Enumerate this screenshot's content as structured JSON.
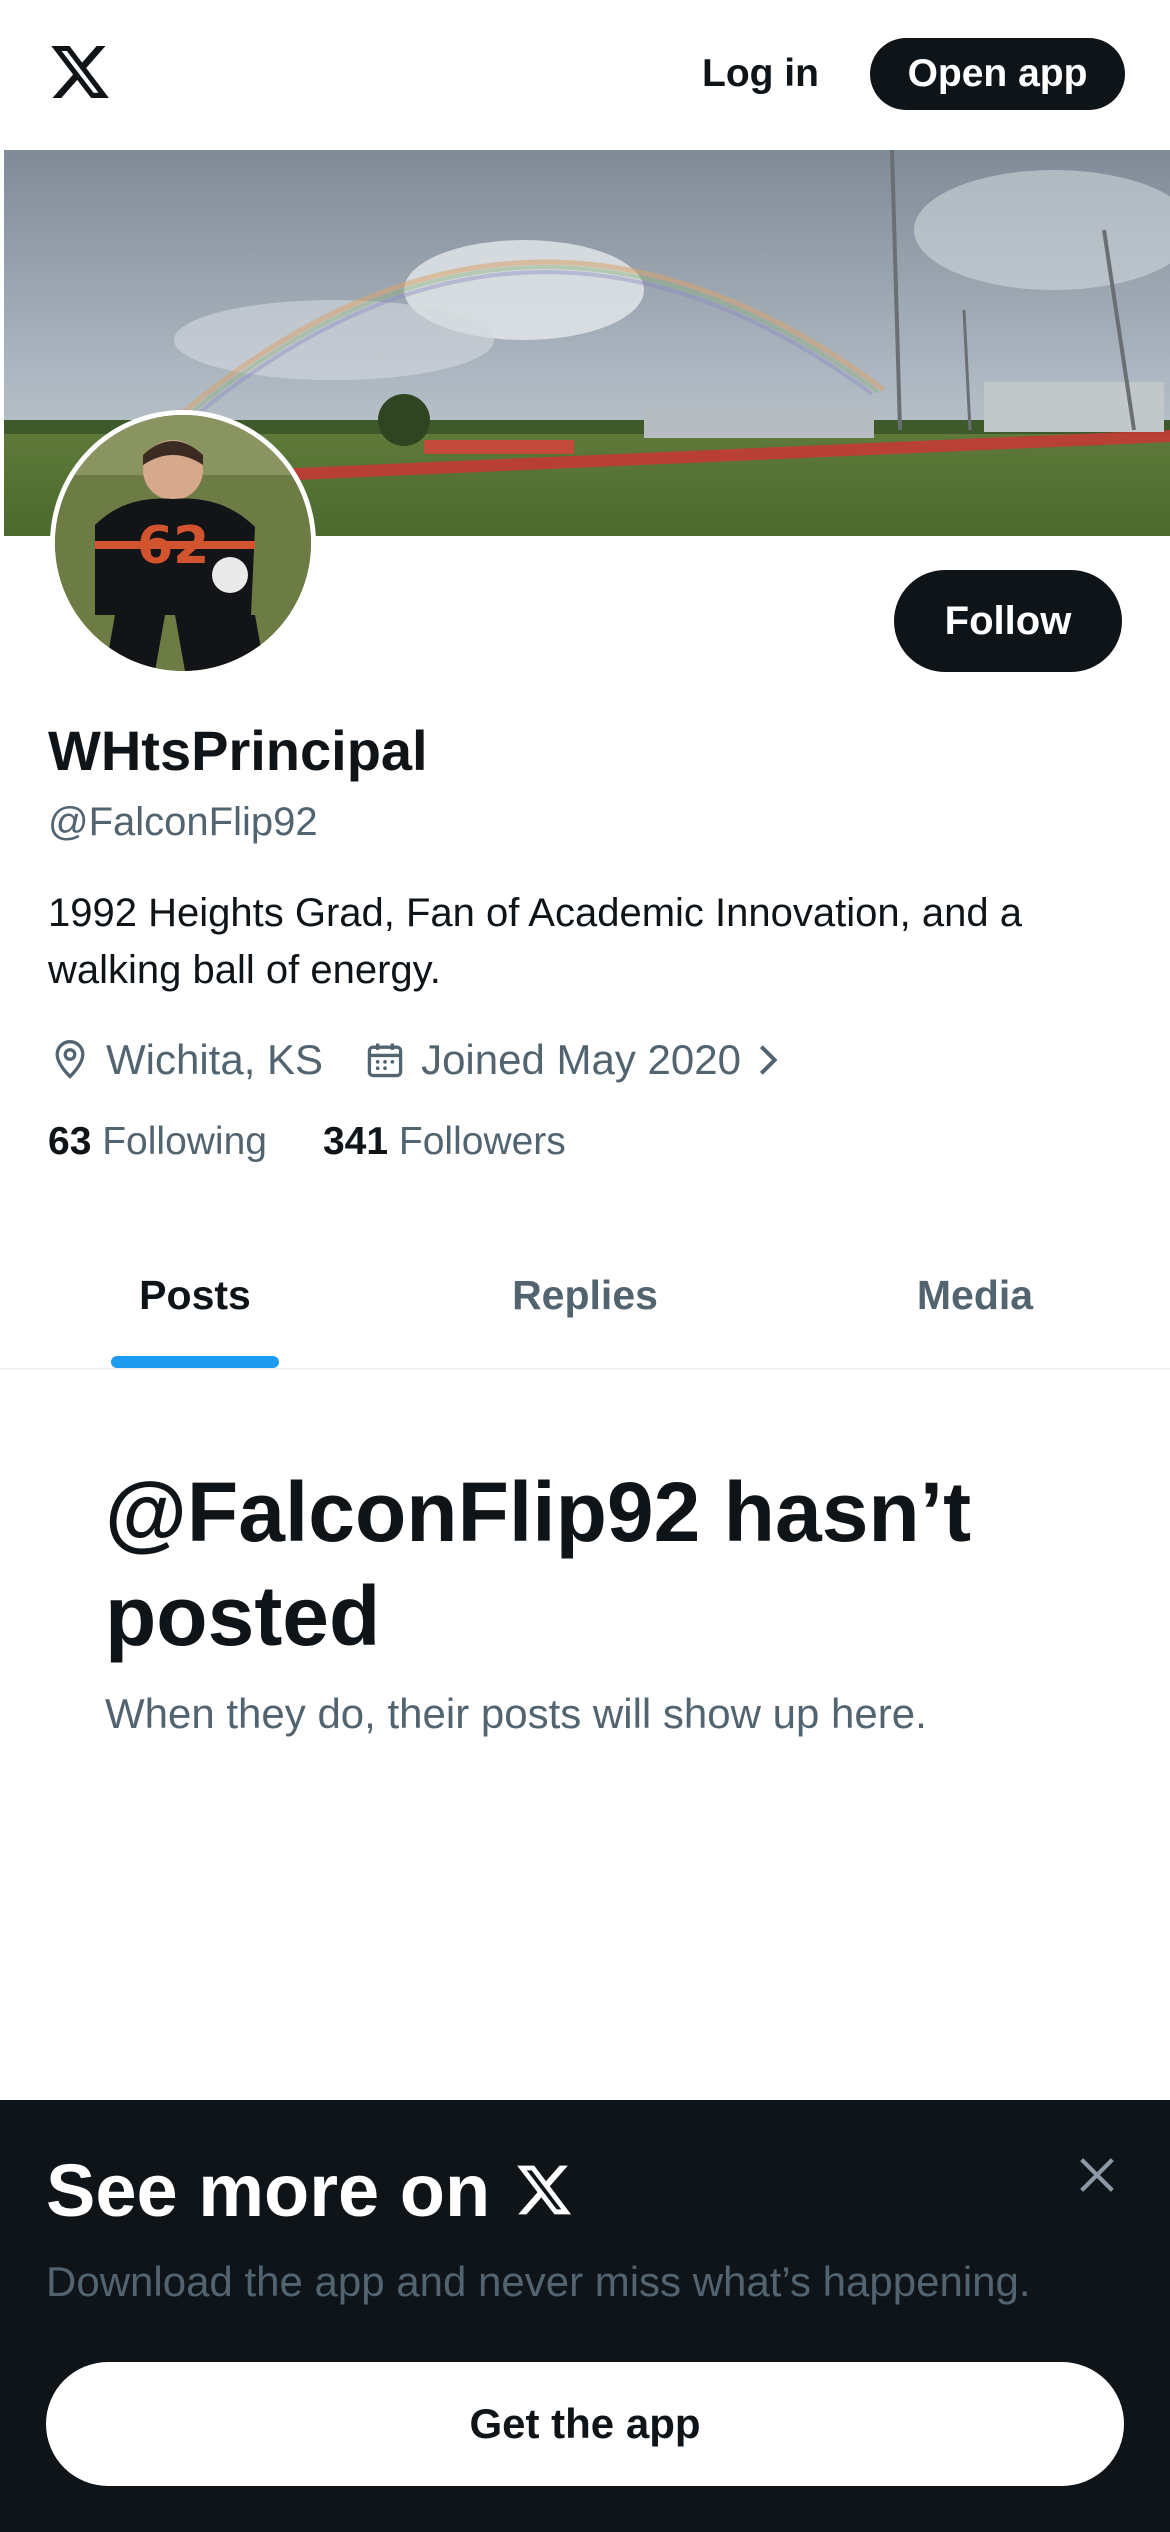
{
  "header": {
    "logo_icon": "x-logo-icon",
    "login_label": "Log in",
    "open_app_label": "Open app"
  },
  "profile": {
    "banner_image": "stadium-rainbow-banner",
    "avatar_image": "football-player-62-avatar",
    "follow_label": "Follow",
    "display_name": "WHtsPrincipal",
    "handle": "@FalconFlip92",
    "bio": "1992 Heights Grad, Fan of Academic Innovation, and a walking ball of energy.",
    "location": "Wichita, KS",
    "joined": "Joined May 2020",
    "following_count": "63",
    "following_label": "Following",
    "followers_count": "341",
    "followers_label": "Followers"
  },
  "tabs": [
    {
      "label": "Posts",
      "active": true
    },
    {
      "label": "Replies",
      "active": false
    },
    {
      "label": "Media",
      "active": false
    }
  ],
  "empty_state": {
    "title": "@FalconFlip92 hasn’t posted",
    "subtitle": "When they do, their posts will show up here."
  },
  "sheet": {
    "title": "See more on",
    "subtitle": "Download the app and never miss what’s happening.",
    "cta_label": "Get the app"
  },
  "colors": {
    "text": "#0f1419",
    "secondary": "#536471",
    "accent": "#1d9bf0",
    "sheet_bg": "#0f1419"
  }
}
